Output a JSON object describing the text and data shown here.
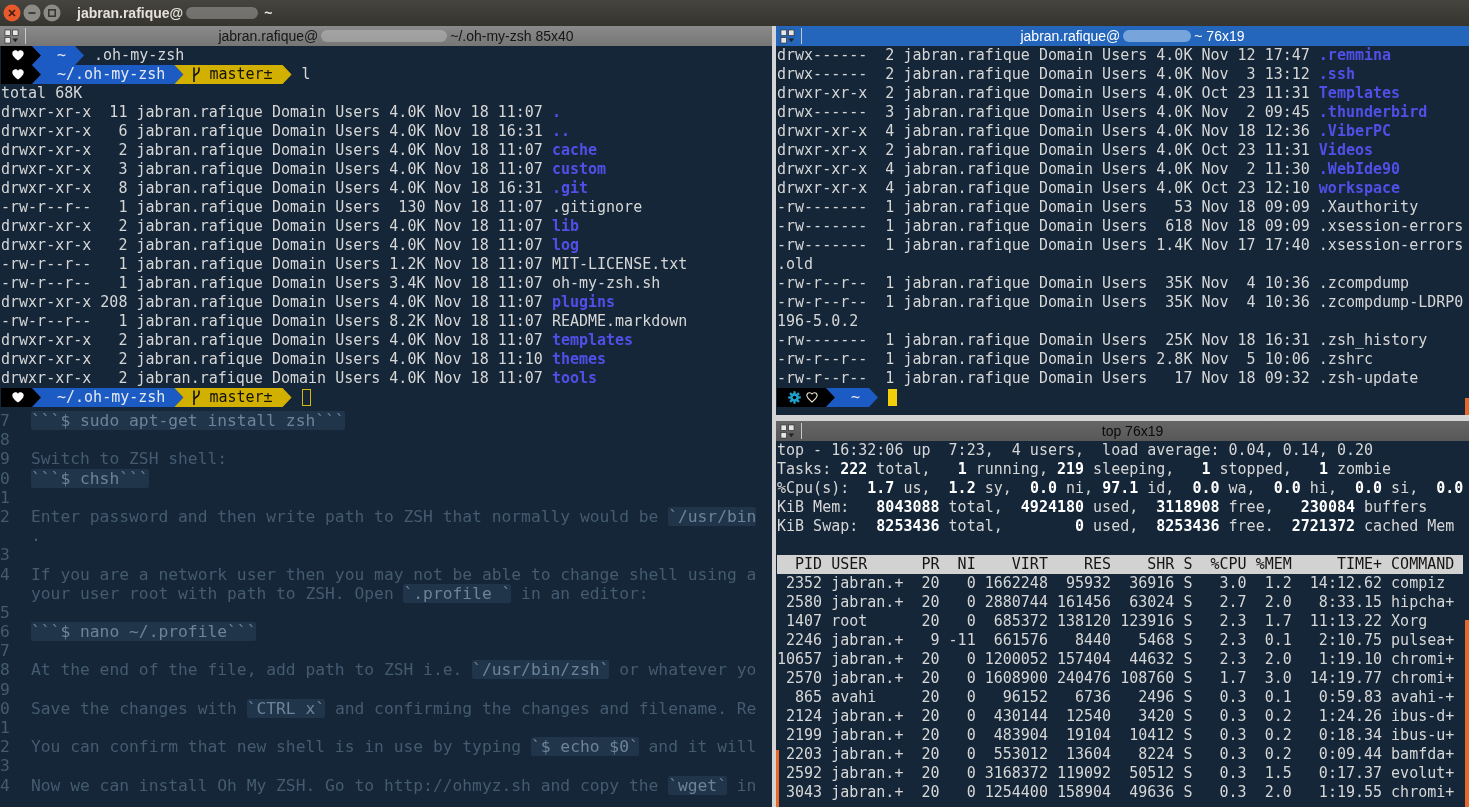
{
  "window": {
    "title": "jabran.rafique@",
    "redacted": true,
    "title_suffix": "~"
  },
  "left_pane": {
    "header": {
      "title": "jabran.rafique@",
      "redacted": true,
      "suffix": "~/.oh-my-zsh 85x40"
    },
    "focused": false,
    "lines": [
      {
        "kind": "prompt",
        "segments": [
          {
            "kind": "status",
            "icons": [
              {
                "kind": "heart"
              }
            ]
          },
          {
            "kind": "path",
            "text": "~"
          }
        ],
        "command": ".oh-my-zsh",
        "cursor": false
      },
      {
        "kind": "prompt",
        "segments": [
          {
            "kind": "status",
            "icons": [
              {
                "kind": "heart"
              }
            ]
          },
          {
            "kind": "path",
            "text": "~/.oh-my-zsh"
          },
          {
            "kind": "git",
            "text": "master±"
          }
        ],
        "command": "l",
        "cursor": false
      },
      {
        "kind": "text",
        "text": "total 68K"
      },
      {
        "kind": "entry",
        "info": "drwxr-xr-x  11 jabran.rafique Domain Users 4.0K Nov 18 11:07",
        "name": ".",
        "directory": true
      },
      {
        "kind": "entry",
        "info": "drwxr-xr-x   6 jabran.rafique Domain Users 4.0K Nov 18 16:31",
        "name": "..",
        "directory": true
      },
      {
        "kind": "entry",
        "info": "drwxr-xr-x   2 jabran.rafique Domain Users 4.0K Nov 18 11:07",
        "name": "cache",
        "directory": true
      },
      {
        "kind": "entry",
        "info": "drwxr-xr-x   3 jabran.rafique Domain Users 4.0K Nov 18 11:07",
        "name": "custom",
        "directory": true
      },
      {
        "kind": "entry",
        "info": "drwxr-xr-x   8 jabran.rafique Domain Users 4.0K Nov 18 16:31",
        "name": ".git",
        "directory": true
      },
      {
        "kind": "entry",
        "info": "-rw-r--r--   1 jabran.rafique Domain Users  130 Nov 18 11:07",
        "name": ".gitignore",
        "directory": false
      },
      {
        "kind": "entry",
        "info": "drwxr-xr-x   2 jabran.rafique Domain Users 4.0K Nov 18 11:07",
        "name": "lib",
        "directory": true
      },
      {
        "kind": "entry",
        "info": "drwxr-xr-x   2 jabran.rafique Domain Users 4.0K Nov 18 11:07",
        "name": "log",
        "directory": true
      },
      {
        "kind": "entry",
        "info": "-rw-r--r--   1 jabran.rafique Domain Users 1.2K Nov 18 11:07",
        "name": "MIT-LICENSE.txt",
        "directory": false
      },
      {
        "kind": "entry",
        "info": "-rw-r--r--   1 jabran.rafique Domain Users 3.4K Nov 18 11:07",
        "name": "oh-my-zsh.sh",
        "directory": false
      },
      {
        "kind": "entry",
        "info": "drwxr-xr-x 208 jabran.rafique Domain Users 4.0K Nov 18 11:07",
        "name": "plugins",
        "directory": true
      },
      {
        "kind": "entry",
        "info": "-rw-r--r--   1 jabran.rafique Domain Users 8.2K Nov 18 11:07",
        "name": "README.markdown",
        "directory": false
      },
      {
        "kind": "entry",
        "info": "drwxr-xr-x   2 jabran.rafique Domain Users 4.0K Nov 18 11:07",
        "name": "templates",
        "directory": true
      },
      {
        "kind": "entry",
        "info": "drwxr-xr-x   2 jabran.rafique Domain Users 4.0K Nov 18 11:10",
        "name": "themes",
        "directory": true
      },
      {
        "kind": "entry",
        "info": "drwxr-xr-x   2 jabran.rafique Domain Users 4.0K Nov 18 11:07",
        "name": "tools",
        "directory": true
      },
      {
        "kind": "prompt",
        "segments": [
          {
            "kind": "status",
            "icons": [
              {
                "kind": "heart"
              }
            ]
          },
          {
            "kind": "path",
            "text": "~/.oh-my-zsh"
          },
          {
            "kind": "git",
            "text": "master±"
          }
        ],
        "cursor": true
      }
    ],
    "background_document": [
      {
        "number": "7",
        "parts": [
          {
            "text": "```$ sudo apt-get install zsh```",
            "code": true
          }
        ]
      },
      {
        "number": "8"
      },
      {
        "number": "9",
        "parts": [
          {
            "text": "Switch to ZSH shell:",
            "code": false
          }
        ]
      },
      {
        "number": "0",
        "parts": [
          {
            "text": "```$ chsh```",
            "code": true
          }
        ]
      },
      {
        "number": "1"
      },
      {
        "number": "2",
        "parts": [
          {
            "text": "Enter password and then write path to ZSH that normally would be ",
            "code": false
          },
          {
            "text": "`/usr/bin",
            "code": true
          }
        ]
      },
      {
        "parts": [
          {
            "text": ".",
            "code": false
          }
        ]
      },
      {
        "number": "3"
      },
      {
        "number": "4",
        "parts": [
          {
            "text": "If you are a network user then you may not be able to change shell using a",
            "code": false
          }
        ]
      },
      {
        "parts": [
          {
            "text": "your user root with path to ZSH. Open ",
            "code": false
          },
          {
            "text": "`.profile `",
            "code": true
          },
          {
            "text": " in an editor:",
            "code": false
          }
        ]
      },
      {
        "number": "5"
      },
      {
        "number": "6",
        "parts": [
          {
            "text": "```$ nano ~/.profile```",
            "code": true
          }
        ]
      },
      {
        "number": "7"
      },
      {
        "number": "8",
        "parts": [
          {
            "text": "At the end of the file, add path to ZSH i.e. ",
            "code": false
          },
          {
            "text": "`/usr/bin/zsh`",
            "code": true
          },
          {
            "text": " or whatever yo",
            "code": false
          }
        ]
      },
      {
        "number": "9"
      },
      {
        "number": "0",
        "parts": [
          {
            "text": "Save the changes with ",
            "code": false
          },
          {
            "text": "`CTRL x`",
            "code": true
          },
          {
            "text": " and confirming the changes and filename. Re",
            "code": false
          }
        ]
      },
      {
        "number": "1"
      },
      {
        "number": "2",
        "parts": [
          {
            "text": "You can confirm that new shell is in use by typing ",
            "code": false
          },
          {
            "text": "`$ echo $0`",
            "code": true
          },
          {
            "text": " and it will",
            "code": false
          }
        ]
      },
      {
        "number": "3"
      },
      {
        "number": "4",
        "parts": [
          {
            "text": "Now we can install Oh My ZSH. Go to http://ohmyz.sh and copy the ",
            "code": false
          },
          {
            "text": "`wget`",
            "code": true
          },
          {
            "text": " in",
            "code": false
          }
        ]
      }
    ]
  },
  "top_right_pane": {
    "header": {
      "title": "jabran.rafique@",
      "redacted": true,
      "suffix": "~ 76x19"
    },
    "focused": true,
    "lines": [
      {
        "kind": "entry",
        "info": "drwx------  2 jabran.rafique Domain Users 4.0K Nov 12 17:47",
        "name": ".remmina",
        "directory": true
      },
      {
        "kind": "entry",
        "info": "drwx------  2 jabran.rafique Domain Users 4.0K Nov  3 13:12",
        "name": ".ssh",
        "directory": true
      },
      {
        "kind": "entry",
        "info": "drwxr-xr-x  2 jabran.rafique Domain Users 4.0K Oct 23 11:31",
        "name": "Templates",
        "directory": true
      },
      {
        "kind": "entry",
        "info": "drwx------  3 jabran.rafique Domain Users 4.0K Nov  2 09:45",
        "name": ".thunderbird",
        "directory": true
      },
      {
        "kind": "entry",
        "info": "drwxr-xr-x  4 jabran.rafique Domain Users 4.0K Nov 18 12:36",
        "name": ".ViberPC",
        "directory": true
      },
      {
        "kind": "entry",
        "info": "drwxr-xr-x  2 jabran.rafique Domain Users 4.0K Oct 23 11:31",
        "name": "Videos",
        "directory": true
      },
      {
        "kind": "entry",
        "info": "drwxr-xr-x  4 jabran.rafique Domain Users 4.0K Nov  2 11:30",
        "name": ".WebIde90",
        "directory": true
      },
      {
        "kind": "entry",
        "info": "drwxr-xr-x  4 jabran.rafique Domain Users 4.0K Oct 23 12:10",
        "name": "workspace",
        "directory": true
      },
      {
        "kind": "entry",
        "info": "-rw-------  1 jabran.rafique Domain Users   53 Nov 18 09:09",
        "name": ".Xauthority",
        "directory": false
      },
      {
        "kind": "entry",
        "info": "-rw-------  1 jabran.rafique Domain Users  618 Nov 18 09:09",
        "name": ".xsession-errors",
        "directory": false
      },
      {
        "kind": "entry",
        "info": "-rw-------  1 jabran.rafique Domain Users 1.4K Nov 17 17:40",
        "name": ".xsession-errors",
        "directory": false
      },
      {
        "kind": "text",
        "text": ".old"
      },
      {
        "kind": "entry",
        "info": "-rw-r--r--  1 jabran.rafique Domain Users  35K Nov  4 10:36",
        "name": ".zcompdump",
        "directory": false
      },
      {
        "kind": "entry",
        "info": "-rw-r--r--  1 jabran.rafique Domain Users  35K Nov  4 10:36",
        "name": ".zcompdump-LDRP0",
        "directory": false
      },
      {
        "kind": "text",
        "text": "196-5.0.2"
      },
      {
        "kind": "entry",
        "info": "-rw-------  1 jabran.rafique Domain Users  25K Nov 18 16:31",
        "name": ".zsh_history",
        "directory": false
      },
      {
        "kind": "entry",
        "info": "-rw-r--r--  1 jabran.rafique Domain Users 2.8K Nov  5 10:06",
        "name": ".zshrc",
        "directory": false
      },
      {
        "kind": "entry",
        "info": "-rw-r--r--  1 jabran.rafique Domain Users   17 Nov 18 09:32",
        "name": ".zsh-update",
        "directory": false
      },
      {
        "kind": "prompt",
        "segments": [
          {
            "kind": "status",
            "icons": [
              {
                "kind": "gear"
              },
              {
                "kind": "hollow-heart"
              }
            ]
          },
          {
            "kind": "path",
            "text": "~"
          }
        ],
        "cursor": true
      }
    ]
  },
  "bottom_right_pane": {
    "header": {
      "title": "top 76x19",
      "redacted": false
    },
    "focused": false,
    "summary": [
      "top - 16:32:06 up  7:23,  4 users,  load average: 0.04, 0.14, 0.20",
      "Tasks: **222** total,   **1** running, **219** sleeping,   **1** stopped,   **1** zombie",
      "%Cpu(s):  **1.7** us,  **1.2** sy,  **0.0** ni, **97.1** id,  **0.0** wa,  **0.0** hi,  **0.0** si,  **0.0**",
      "KiB Mem:   **8043088** total,  **4924180** used,  **3118908** free,   **230084** buffers",
      "KiB Swap:  **8253436** total,        **0** used,  **8253436** free.  **2721372** cached Mem"
    ],
    "table_header": "  PID USER      PR  NI    VIRT    RES    SHR S  %CPU %MEM     TIME+ COMMAND",
    "processes": [
      " 2352 jabran.+  20   0 1662248  95932  36916 S   3.0  1.2  14:12.62 compiz",
      " 2580 jabran.+  20   0 2880744 161456  63024 S   2.7  2.0   8:33.15 hipcha+",
      " 1407 root      20   0  685372 138120 123916 S   2.3  1.7  11:13.22 Xorg",
      " 2246 jabran.+   9 -11  661576   8440   5468 S   2.3  0.1   2:10.75 pulsea+",
      "10657 jabran.+  20   0 1200052 157404  44632 S   2.3  2.0   1:19.10 chromi+",
      " 2570 jabran.+  20   0 1608900 240476 108760 S   1.7  3.0  14:19.77 chromi+",
      "  865 avahi     20   0   96152   6736   2496 S   0.3  0.1   0:59.83 avahi-+",
      " 2124 jabran.+  20   0  430144  12540   3420 S   0.3  0.2   1:24.26 ibus-d+",
      " 2199 jabran.+  20   0  483904  19104  10412 S   0.3  0.2   0:18.34 ibus-u+",
      " 2203 jabran.+  20   0  553012  13604   8224 S   0.3  0.2   0:09.44 bamfda+",
      " 2592 jabran.+  20   0 3168372 119092  50512 S   0.3  1.5   0:17.37 evolut+",
      " 3043 jabran.+  20   0 1254400 158904  49636 S   0.3  2.0   1:19.55 chromi+"
    ]
  }
}
